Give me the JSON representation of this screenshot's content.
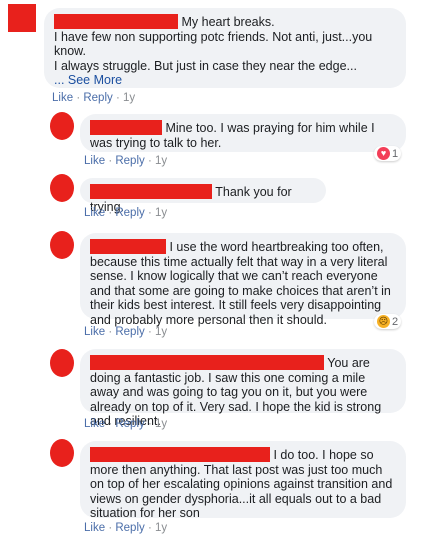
{
  "actions": {
    "like": "Like",
    "reply": "Reply",
    "sep": "·"
  },
  "see_more": "... See More",
  "comments": [
    {
      "text": "My heart breaks.\nI have few non supporting potc friends. Not anti, just...you know.\nI always struggle. But just in case they near the edge...",
      "time": "1y"
    },
    {
      "text": "Mine too. I was praying for him while I was trying to talk to her.",
      "time": "1y",
      "reaction": {
        "icon": "heart-icon",
        "count": "1"
      }
    },
    {
      "text": "Thank you for trying.",
      "time": "1y"
    },
    {
      "text": "I use the word heartbreaking too often, because this time actually felt that way in a very literal sense. I know logically that we can’t reach everyone and that some are going to make choices that aren’t in their kids best interest. It still feels very disappointing and probably more personal then it should.",
      "time": "1y",
      "reaction": {
        "icon": "sad-icon",
        "count": "2"
      }
    },
    {
      "text": "You are doing a fantastic job. I saw this one coming a mile away and was going to tag you on it, but you were already on top of it. Very sad. I hope the kid is strong and resilient.",
      "time": "1y"
    },
    {
      "text": "I do too. I hope so more then anything. That last post was just too much on top of her escalating opinions against transition and views on gender dysphoria...it all equals out to a bad situation for her son",
      "time": "1y"
    }
  ]
}
